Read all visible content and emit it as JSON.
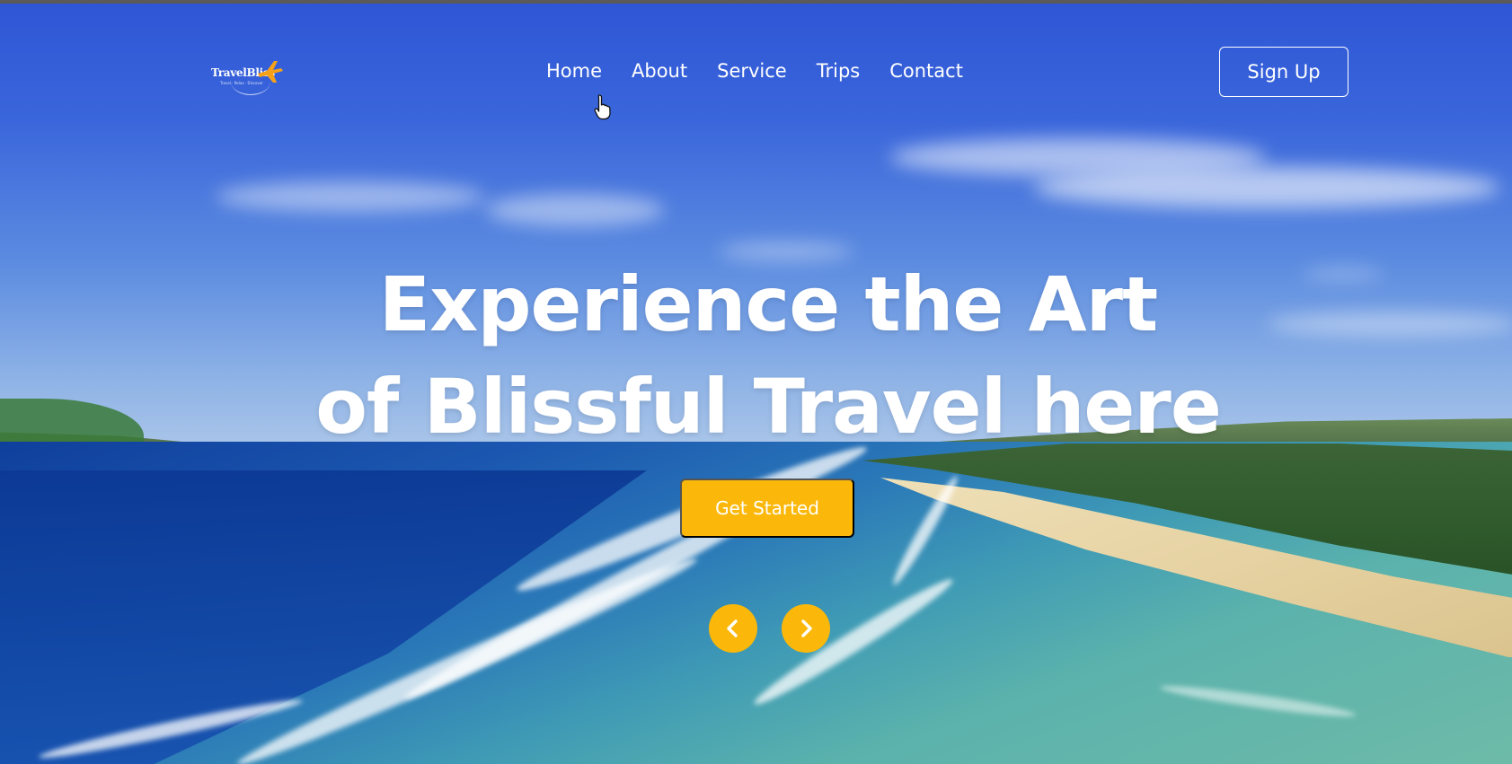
{
  "brand": {
    "name": "TravelBliss",
    "tagline": "Travel · Relax · Discover"
  },
  "nav": {
    "items": [
      {
        "label": "Home"
      },
      {
        "label": "About"
      },
      {
        "label": "Service"
      },
      {
        "label": "Trips"
      },
      {
        "label": "Contact"
      }
    ],
    "signup_label": "Sign Up"
  },
  "hero": {
    "headline_line1": "Experience the Art",
    "headline_line2": "of Blissful Travel here",
    "cta_label": "Get Started",
    "background": "beach-coastline-photo"
  },
  "carousel": {
    "prev_icon": "chevron-left-icon",
    "next_icon": "chevron-right-icon"
  },
  "colors": {
    "accent": "#fbb80b",
    "text": "#ffffff",
    "sky": "#3a66db"
  }
}
